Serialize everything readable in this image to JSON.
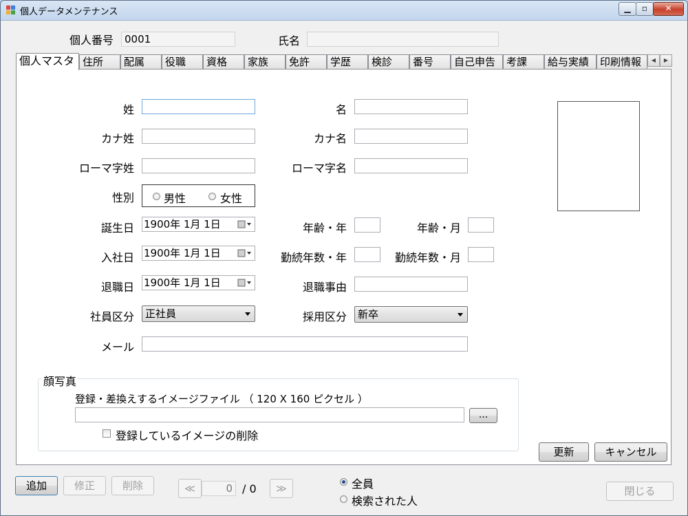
{
  "window": {
    "title": "個人データメンテナンス"
  },
  "header": {
    "person_id_label": "個人番号",
    "person_id_value": "0001",
    "name_label": "氏名",
    "name_value": ""
  },
  "tabs": [
    "個人マスタ",
    "住所",
    "配属",
    "役職",
    "資格",
    "家族",
    "免許",
    "学歴",
    "検診",
    "番号",
    "自己申告",
    "考課",
    "給与実績",
    "印刷情報"
  ],
  "form": {
    "sei_label": "姓",
    "sei_value": "",
    "mei_label": "名",
    "mei_value": "",
    "kana_sei_label": "カナ姓",
    "kana_sei_value": "",
    "kana_mei_label": "カナ名",
    "kana_mei_value": "",
    "roma_sei_label": "ローマ字姓",
    "roma_sei_value": "",
    "roma_mei_label": "ローマ字名",
    "roma_mei_value": "",
    "gender_label": "性別",
    "male_label": "男性",
    "female_label": "女性",
    "birth_label": "誕生日",
    "birth_value": "1900年  1月  1日",
    "age_year_label": "年齢・年",
    "age_year_value": "",
    "age_month_label": "年齢・月",
    "age_month_value": "",
    "join_label": "入社日",
    "join_value": "1900年  1月  1日",
    "service_year_label": "勤続年数・年",
    "service_year_value": "",
    "service_month_label": "勤続年数・月",
    "service_month_value": "",
    "retire_label": "退職日",
    "retire_value": "1900年  1月  1日",
    "retire_reason_label": "退職事由",
    "retire_reason_value": "",
    "emp_type_label": "社員区分",
    "emp_type_value": "正社員",
    "hire_type_label": "採用区分",
    "hire_type_value": "新卒",
    "mail_label": "メール",
    "mail_value": ""
  },
  "photo": {
    "group_label": "顔写真",
    "file_label": "登録・差換えするイメージファイル （ 120 X 160 ピクセル ）",
    "file_value": "",
    "browse_label": "...",
    "delete_label": "登録しているイメージの削除"
  },
  "actions": {
    "update": "更新",
    "cancel": "キャンセル"
  },
  "footer": {
    "add": "追加",
    "edit": "修正",
    "delete": "削除",
    "prev": "≪",
    "next": "≫",
    "position": "0",
    "total": "/ 0",
    "all_label": "全員",
    "searched_label": "検索された人",
    "close": "閉じる"
  }
}
